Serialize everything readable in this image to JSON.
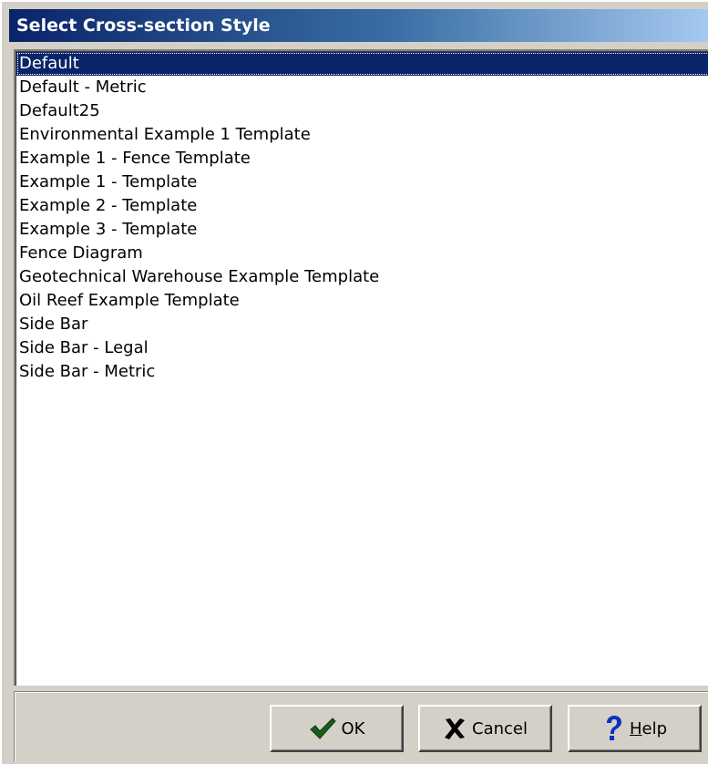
{
  "window": {
    "title": "Select Cross-section Style"
  },
  "list": {
    "selected_index": 0,
    "items": [
      "Default",
      "Default - Metric",
      "Default25",
      "Environmental Example 1 Template",
      "Example 1 - Fence Template",
      "Example 1 - Template",
      "Example 2 - Template",
      "Example 3 - Template",
      "Fence Diagram",
      "Geotechnical Warehouse Example Template",
      "Oil Reef Example Template",
      "Side Bar",
      "Side Bar - Legal",
      "Side Bar - Metric"
    ]
  },
  "buttons": {
    "ok": {
      "label": "OK",
      "icon": "checkmark-icon",
      "icon_color": "#1a5c1a"
    },
    "cancel": {
      "label": "Cancel",
      "icon": "x-icon",
      "icon_color": "#000000"
    },
    "help": {
      "label": "Help",
      "icon": "question-mark-icon",
      "icon_color": "#1030c0"
    }
  },
  "colors": {
    "selection_bg": "#0a246a",
    "title_gradient_start": "#0a246a",
    "title_gradient_end": "#a6caf0",
    "face": "#d4d0c8"
  }
}
